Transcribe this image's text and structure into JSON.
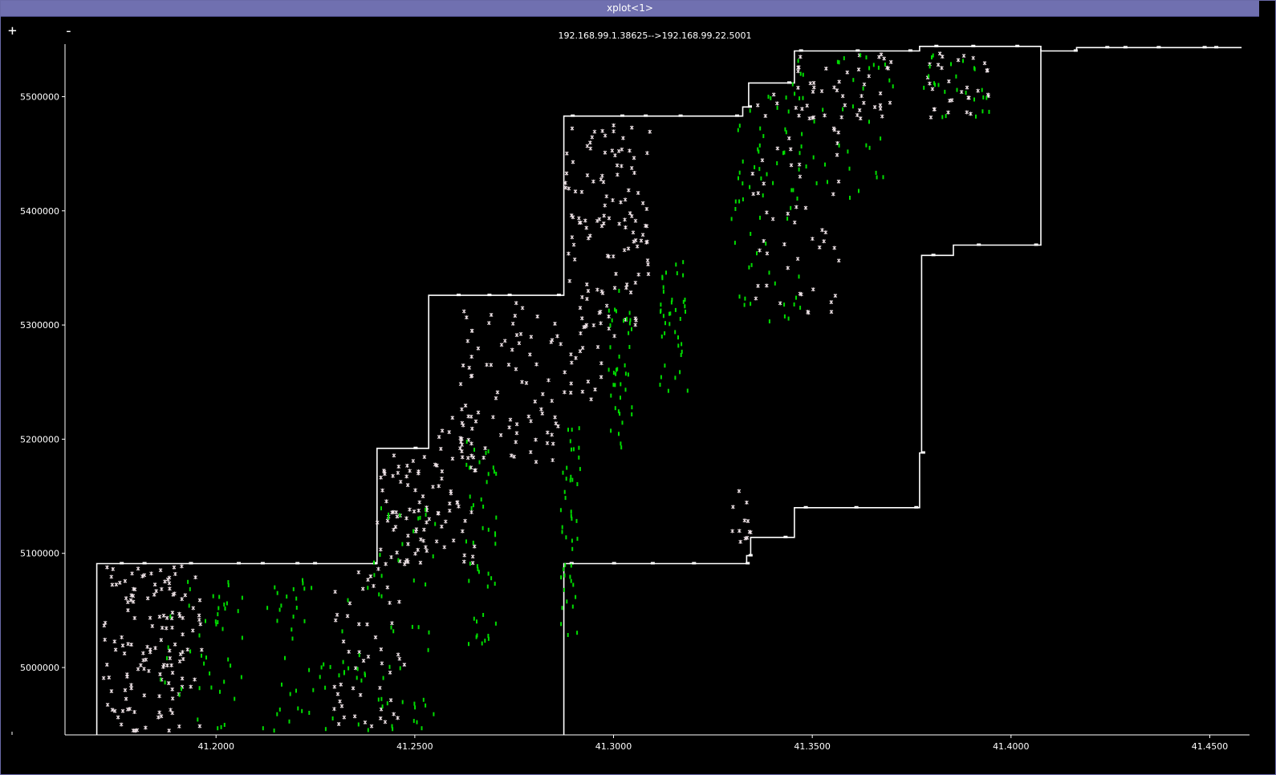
{
  "window": {
    "title": "xplot<1>"
  },
  "controls": {
    "zoom_in": "+",
    "zoom_out": "-"
  },
  "colors": {
    "background": "#000000",
    "titlebar": "#7070b0",
    "foreground": "#ffffff",
    "sack": "#00dd00"
  },
  "chart_data": {
    "type": "scatter",
    "title": "192.168.99.1.38625-->192.168.99.22.5001",
    "xlim": [
      41.162,
      41.46
    ],
    "ylim": [
      4941000,
      5546000
    ],
    "x_ticks": [
      {
        "value": 41.2,
        "label": "41.2000"
      },
      {
        "value": 41.25,
        "label": "41.2500"
      },
      {
        "value": 41.3,
        "label": "41.3000"
      },
      {
        "value": 41.35,
        "label": "41.3500"
      },
      {
        "value": 41.4,
        "label": "41.4000"
      },
      {
        "value": 41.45,
        "label": "41.4500"
      }
    ],
    "y_ticks": [
      {
        "value": 5000000,
        "label": "5000000"
      },
      {
        "value": 5100000,
        "label": "5100000"
      },
      {
        "value": 5200000,
        "label": "5200000"
      },
      {
        "value": 5300000,
        "label": "5300000"
      },
      {
        "value": 5400000,
        "label": "5400000"
      },
      {
        "value": 5500000,
        "label": "5500000"
      }
    ],
    "series": [
      {
        "kind": "window_upper",
        "points": [
          [
            41.17,
            4941000
          ],
          [
            41.17,
            5091000
          ],
          [
            41.2405,
            5091000
          ],
          [
            41.2405,
            5192000
          ],
          [
            41.2535,
            5192000
          ],
          [
            41.2535,
            5326000
          ],
          [
            41.2875,
            5326000
          ],
          [
            41.2875,
            5483000
          ],
          [
            41.3325,
            5483000
          ],
          [
            41.3325,
            5491000
          ],
          [
            41.334,
            5491000
          ],
          [
            41.334,
            5512000
          ],
          [
            41.3455,
            5512000
          ],
          [
            41.3455,
            5540000
          ],
          [
            41.377,
            5540000
          ],
          [
            41.377,
            5544000
          ],
          [
            41.4075,
            5544000
          ],
          [
            41.4075,
            5540000
          ],
          [
            41.4165,
            5540000
          ],
          [
            41.4165,
            5543000
          ],
          [
            41.458,
            5543000
          ]
        ]
      },
      {
        "kind": "ack",
        "points": [
          [
            41.2875,
            4941000
          ],
          [
            41.2875,
            5091000
          ],
          [
            41.3335,
            5091000
          ],
          [
            41.3335,
            5098000
          ],
          [
            41.3345,
            5098000
          ],
          [
            41.3345,
            5114000
          ],
          [
            41.3455,
            5114000
          ],
          [
            41.3455,
            5140000
          ],
          [
            41.377,
            5140000
          ],
          [
            41.377,
            5188000
          ],
          [
            41.3775,
            5188000
          ],
          [
            41.3775,
            5361000
          ],
          [
            41.3855,
            5361000
          ],
          [
            41.3855,
            5370000
          ],
          [
            41.4075,
            5370000
          ],
          [
            41.4075,
            5542000
          ]
        ]
      },
      {
        "kind": "data_segments",
        "clusters": [
          {
            "x0": 41.1715,
            "x1": 41.1965,
            "y0": 4944000,
            "y1": 5089000,
            "n": 140
          },
          {
            "x0": 41.2295,
            "x1": 41.2475,
            "y0": 4944000,
            "y1": 5089000,
            "n": 50
          },
          {
            "x0": 41.2405,
            "x1": 41.2535,
            "y0": 5090000,
            "y1": 5188000,
            "n": 60
          },
          {
            "x0": 41.2535,
            "x1": 41.2655,
            "y0": 5090000,
            "y1": 5220000,
            "n": 50
          },
          {
            "x0": 41.2615,
            "x1": 41.2875,
            "y0": 5180000,
            "y1": 5324000,
            "n": 80
          },
          {
            "x0": 41.2875,
            "x1": 41.2975,
            "y0": 5230000,
            "y1": 5480000,
            "n": 70
          },
          {
            "x0": 41.2975,
            "x1": 41.3095,
            "y0": 5290000,
            "y1": 5480000,
            "n": 70
          },
          {
            "x0": 41.3345,
            "x1": 41.3575,
            "y0": 5310000,
            "y1": 5510000,
            "n": 55
          },
          {
            "x0": 41.3455,
            "x1": 41.3715,
            "y0": 5480000,
            "y1": 5538000,
            "n": 45
          },
          {
            "x0": 41.3775,
            "x1": 41.3945,
            "y0": 5480000,
            "y1": 5538000,
            "n": 30
          },
          {
            "x0": 41.3295,
            "x1": 41.3345,
            "y0": 5110000,
            "y1": 5160000,
            "n": 12
          }
        ]
      },
      {
        "kind": "sack_segments",
        "clusters": [
          {
            "x0": 41.1855,
            "x1": 41.2065,
            "y0": 4944000,
            "y1": 5088000,
            "n": 45
          },
          {
            "x0": 41.2115,
            "x1": 41.2385,
            "y0": 4944000,
            "y1": 5088000,
            "n": 55
          },
          {
            "x0": 41.2385,
            "x1": 41.2555,
            "y0": 4944000,
            "y1": 5140000,
            "n": 45
          },
          {
            "x0": 41.2625,
            "x1": 41.2705,
            "y0": 5020000,
            "y1": 5200000,
            "n": 45
          },
          {
            "x0": 41.2865,
            "x1": 41.2915,
            "y0": 5020000,
            "y1": 5220000,
            "n": 45
          },
          {
            "x0": 41.2985,
            "x1": 41.3045,
            "y0": 5190000,
            "y1": 5330000,
            "n": 40
          },
          {
            "x0": 41.3115,
            "x1": 41.3185,
            "y0": 5230000,
            "y1": 5360000,
            "n": 40
          },
          {
            "x0": 41.3295,
            "x1": 41.3475,
            "y0": 5300000,
            "y1": 5500000,
            "n": 60
          },
          {
            "x0": 41.3445,
            "x1": 41.3705,
            "y0": 5410000,
            "y1": 5536000,
            "n": 45
          },
          {
            "x0": 41.3765,
            "x1": 41.3945,
            "y0": 5480000,
            "y1": 5538000,
            "n": 25
          }
        ]
      }
    ]
  }
}
